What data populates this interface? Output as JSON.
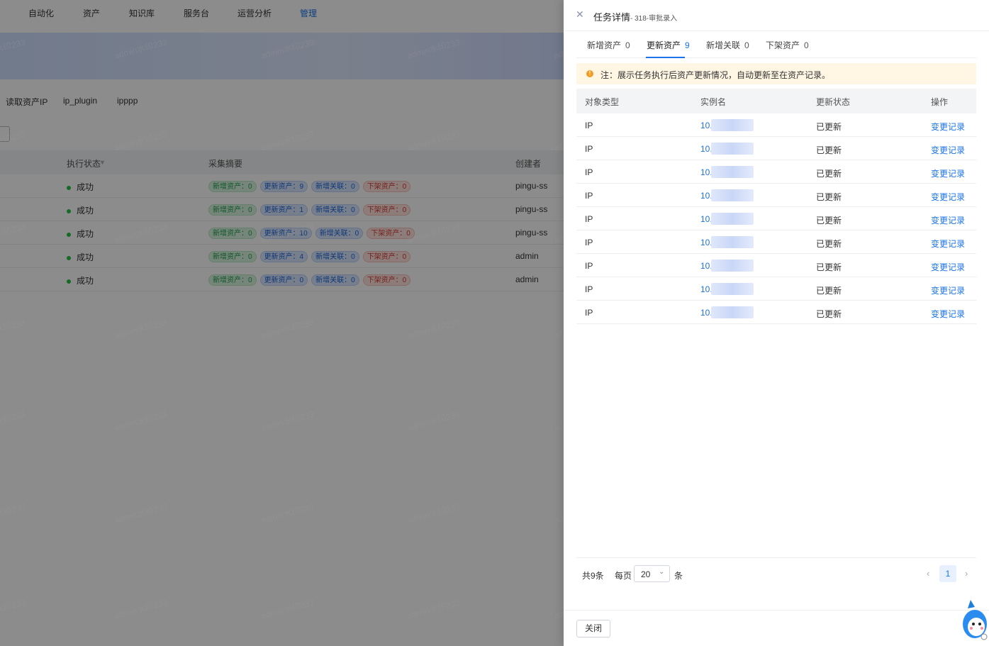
{
  "background": {
    "nav": [
      {
        "label": "自动化"
      },
      {
        "label": "资产"
      },
      {
        "label": "知识库"
      },
      {
        "label": "服务台"
      },
      {
        "label": "运营分析"
      },
      {
        "label": "管理",
        "active": true
      }
    ],
    "subtabs": [
      "读取资产IP",
      "ip_plugin",
      "ipppp"
    ],
    "table": {
      "headers": {
        "status": "执行状态",
        "summary": "采集摘要",
        "creator": "创建者"
      },
      "rows": [
        {
          "status": "成功",
          "add": "新增资产：0",
          "update": "更新资产：9",
          "rel": "新增关联：0",
          "off": "下架资产：0",
          "creator": "pingu-ss"
        },
        {
          "status": "成功",
          "add": "新增资产：0",
          "update": "更新资产：1",
          "rel": "新增关联：0",
          "off": "下架资产：0",
          "creator": "pingu-ss"
        },
        {
          "status": "成功",
          "add": "新增资产：0",
          "update": "更新资产：10",
          "rel": "新增关联：0",
          "off": "下架资产：0",
          "creator": "pingu-ss"
        },
        {
          "status": "成功",
          "add": "新增资产：0",
          "update": "更新资产：4",
          "rel": "新增关联：0",
          "off": "下架资产：0",
          "creator": "admin"
        },
        {
          "status": "成功",
          "add": "新增资产：0",
          "update": "更新资产：0",
          "rel": "新增关联：0",
          "off": "下架资产：0",
          "creator": "admin"
        }
      ]
    },
    "watermark": "admin水印233"
  },
  "drawer": {
    "title": "任务详情",
    "subtitle": "- 318-审批录入",
    "tabs": [
      {
        "label": "新增资产",
        "count": "0"
      },
      {
        "label": "更新资产",
        "count": "9",
        "active": true
      },
      {
        "label": "新增关联",
        "count": "0"
      },
      {
        "label": "下架资产",
        "count": "0"
      }
    ],
    "notice": "注：展示任务执行后资产更新情况，自动更新至在资产记录。",
    "table": {
      "headers": {
        "type": "对象类型",
        "instance": "实例名",
        "status": "更新状态",
        "action": "操作"
      },
      "rows": [
        {
          "type": "IP",
          "instance": "10.",
          "status": "已更新",
          "action": "变更记录"
        },
        {
          "type": "IP",
          "instance": "10.",
          "status": "已更新",
          "action": "变更记录"
        },
        {
          "type": "IP",
          "instance": "10.",
          "status": "已更新",
          "action": "变更记录"
        },
        {
          "type": "IP",
          "instance": "10.",
          "status": "已更新",
          "action": "变更记录"
        },
        {
          "type": "IP",
          "instance": "10.",
          "status": "已更新",
          "action": "变更记录"
        },
        {
          "type": "IP",
          "instance": "10.",
          "status": "已更新",
          "action": "变更记录"
        },
        {
          "type": "IP",
          "instance": "10.",
          "status": "已更新",
          "action": "变更记录"
        },
        {
          "type": "IP",
          "instance": "10.",
          "status": "已更新",
          "action": "变更记录"
        },
        {
          "type": "IP",
          "instance": "10.",
          "status": "已更新",
          "action": "变更记录"
        }
      ]
    },
    "pagination": {
      "total": "共9条",
      "per_page_label": "每页",
      "page_size": "20",
      "unit": "条",
      "current_page": "1"
    },
    "close_button": "关闭"
  },
  "colors": {
    "accent": "#1a73e8",
    "success": "#23c343",
    "warning": "#f59a23"
  }
}
